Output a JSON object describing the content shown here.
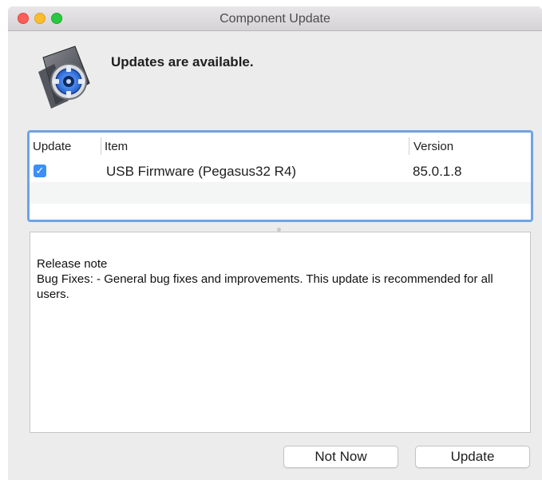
{
  "window": {
    "title": "Component Update"
  },
  "header": {
    "headline": "Updates are available.",
    "icon": "settings-disk-icon"
  },
  "table": {
    "columns": [
      "Update",
      "Item",
      "Version"
    ],
    "rows": [
      {
        "checked": true,
        "item": "USB Firmware (Pegasus32 R4)",
        "version": "85.0.1.8"
      }
    ]
  },
  "release_notes": {
    "heading": "Release note",
    "body": "Bug Fixes: - General bug fixes and improvements. This update is recommended for all users."
  },
  "buttons": {
    "not_now": "Not Now",
    "update": "Update"
  },
  "colors": {
    "accent": "#3b8ff6",
    "selection_border": "#6fa3e3",
    "close": "#fc5f57",
    "minimize": "#fdbc2e",
    "maximize": "#28c840"
  }
}
